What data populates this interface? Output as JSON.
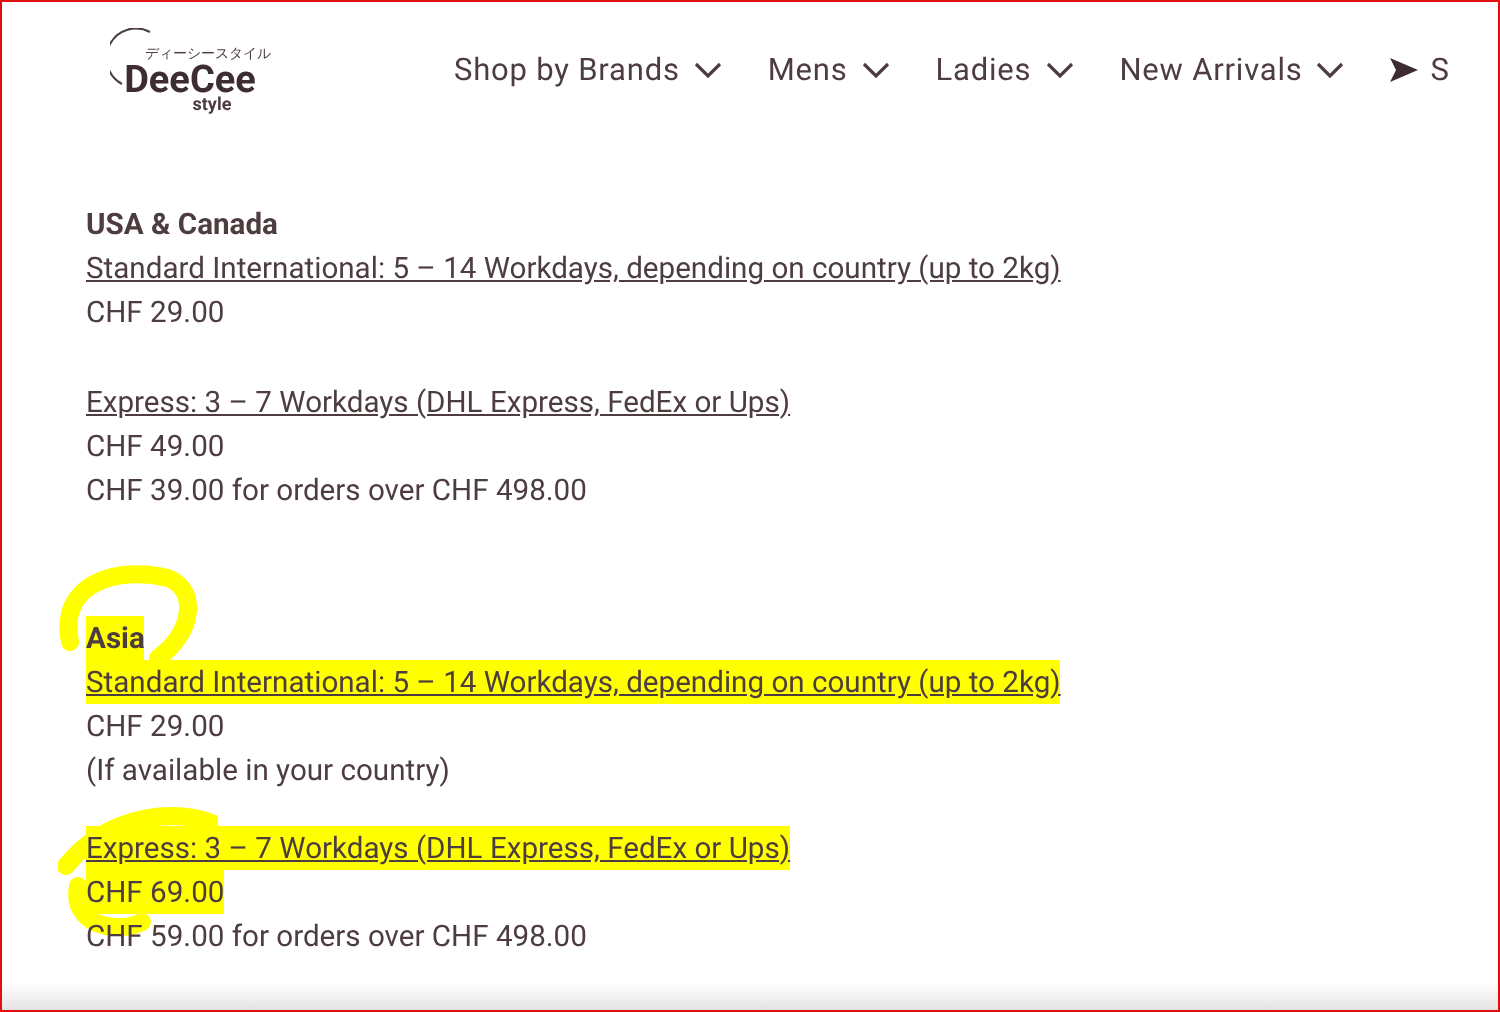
{
  "header": {
    "logo": {
      "kana": "ディーシースタイル",
      "name": "DeeCee",
      "sub": "style"
    },
    "nav": [
      {
        "label": "Shop by Brands",
        "kind": "dropdown"
      },
      {
        "label": "Mens",
        "kind": "dropdown"
      },
      {
        "label": "Ladies",
        "kind": "dropdown"
      },
      {
        "label": "New Arrivals",
        "kind": "dropdown"
      },
      {
        "label": "S",
        "kind": "arrow"
      }
    ]
  },
  "sections": [
    {
      "heading": "USA & Canada",
      "highlighted": false,
      "blocks": [
        [
          {
            "kind": "link",
            "text": "Standard International: 5 – 14 Workdays, depending on country (up to 2kg)",
            "highlighted": false
          },
          {
            "kind": "text",
            "text": "CHF 29.00",
            "highlighted": false
          }
        ],
        [
          {
            "kind": "link",
            "text": "Express: 3 – 7 Workdays (DHL Express, FedEx or Ups)",
            "highlighted": false
          },
          {
            "kind": "text",
            "text": "CHF 49.00",
            "highlighted": false
          },
          {
            "kind": "text",
            "text": "CHF 39.00 for orders over CHF 498.00",
            "highlighted": false
          }
        ]
      ]
    },
    {
      "heading": "Asia",
      "highlighted": true,
      "blocks": [
        [
          {
            "kind": "link",
            "text": "Standard International: 5 – 14 Workdays, depending on country (up to 2kg)",
            "highlighted": true
          },
          {
            "kind": "text",
            "text": "CHF 29.00",
            "highlighted": false
          },
          {
            "kind": "text",
            "text": "(If available in your country)",
            "highlighted": false
          }
        ],
        [
          {
            "kind": "link",
            "text": "Express: 3 – 7 Workdays (DHL Express, FedEx or Ups)",
            "highlighted": true
          },
          {
            "kind": "text",
            "text": "CHF 69.00",
            "highlighted": true
          },
          {
            "kind": "text",
            "text": "CHF 59.00 for orders over CHF 498.00",
            "highlighted": false
          }
        ]
      ]
    }
  ]
}
